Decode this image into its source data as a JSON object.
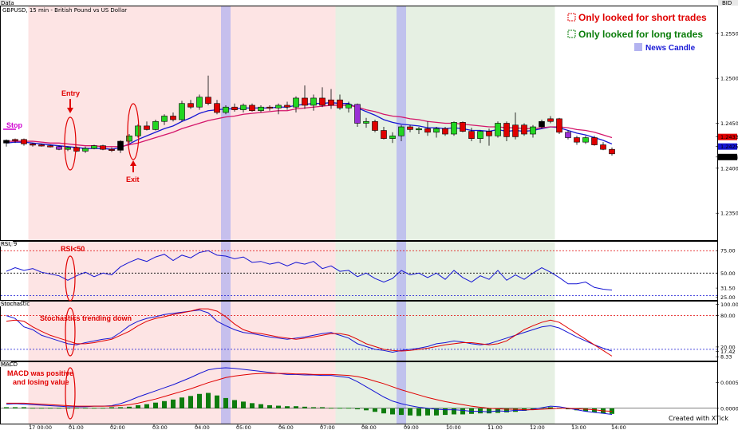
{
  "panes": {
    "price_label": "Data",
    "rsi_label": "RSI, 9",
    "stoch_label": "Stochastic",
    "macd_label": "MACD",
    "corner_label": "BID"
  },
  "title": "GBPUSD, 15 min - British Pound vs US Dollar",
  "legend": {
    "short": "Only looked for short trades",
    "long": "Only looked for long trades",
    "news": "News Candle",
    "short_color": "#e00000",
    "long_color": "#0a7d0a",
    "news_color": "#b3b3f0"
  },
  "annotations": {
    "stop": "Stop",
    "entry": "Entry",
    "exit": "Exit",
    "rsi": "RSI<50",
    "stoch": "Stochastics trending down",
    "macd_line1": "MACD was positive",
    "macd_line2": "and losing value"
  },
  "credit": "Created with XTick",
  "chart_data": {
    "type": "candlestick",
    "title": "GBPUSD, 15 min - British Pound vs US Dollar",
    "x_ticks": [
      "17 00:00",
      "01:00",
      "02:00",
      "03:00",
      "04:00",
      "05:00",
      "06:00",
      "07:00",
      "08:00",
      "09:00",
      "10:00",
      "11:00",
      "12:00",
      "13:00",
      "14:00"
    ],
    "price_axis": {
      "ticks": [
        "1.2550",
        "1.2500",
        "1.2450",
        "1.2400",
        "1.2350"
      ],
      "ylim": [
        1.232,
        1.258
      ],
      "value_labels": [
        "1.2433",
        "1.2425",
        "1.2416"
      ]
    },
    "candles": [
      {
        "o": 1.2428,
        "h": 1.2432,
        "l": 1.2424,
        "c": 1.2431,
        "color": "black"
      },
      {
        "o": 1.2431,
        "h": 1.2433,
        "l": 1.2428,
        "c": 1.2432,
        "color": "red"
      },
      {
        "o": 1.2432,
        "h": 1.2433,
        "l": 1.2425,
        "c": 1.2427,
        "color": "red"
      },
      {
        "o": 1.2427,
        "h": 1.2428,
        "l": 1.2424,
        "c": 1.2426,
        "color": "red"
      },
      {
        "o": 1.2426,
        "h": 1.2427,
        "l": 1.2424,
        "c": 1.2425,
        "color": "red"
      },
      {
        "o": 1.2425,
        "h": 1.2426,
        "l": 1.2423,
        "c": 1.2424,
        "color": "red"
      },
      {
        "o": 1.2424,
        "h": 1.2425,
        "l": 1.242,
        "c": 1.2421,
        "color": "purple"
      },
      {
        "o": 1.2421,
        "h": 1.2424,
        "l": 1.2419,
        "c": 1.2423,
        "color": "green"
      },
      {
        "o": 1.2423,
        "h": 1.2424,
        "l": 1.2418,
        "c": 1.2419,
        "color": "red"
      },
      {
        "o": 1.2419,
        "h": 1.2424,
        "l": 1.2417,
        "c": 1.2422,
        "color": "green"
      },
      {
        "o": 1.2422,
        "h": 1.2426,
        "l": 1.2421,
        "c": 1.2425,
        "color": "green"
      },
      {
        "o": 1.2425,
        "h": 1.2426,
        "l": 1.242,
        "c": 1.2421,
        "color": "red"
      },
      {
        "o": 1.2421,
        "h": 1.2423,
        "l": 1.2418,
        "c": 1.242,
        "color": "red"
      },
      {
        "o": 1.242,
        "h": 1.2431,
        "l": 1.2417,
        "c": 1.243,
        "color": "black"
      },
      {
        "o": 1.243,
        "h": 1.2438,
        "l": 1.2428,
        "c": 1.2436,
        "color": "green"
      },
      {
        "o": 1.2436,
        "h": 1.2449,
        "l": 1.2434,
        "c": 1.2447,
        "color": "green"
      },
      {
        "o": 1.2447,
        "h": 1.2452,
        "l": 1.2442,
        "c": 1.2443,
        "color": "red"
      },
      {
        "o": 1.2443,
        "h": 1.2454,
        "l": 1.2442,
        "c": 1.2452,
        "color": "green"
      },
      {
        "o": 1.2452,
        "h": 1.246,
        "l": 1.2448,
        "c": 1.2458,
        "color": "green"
      },
      {
        "o": 1.2458,
        "h": 1.2462,
        "l": 1.2452,
        "c": 1.2454,
        "color": "red"
      },
      {
        "o": 1.2454,
        "h": 1.2475,
        "l": 1.2452,
        "c": 1.2472,
        "color": "green"
      },
      {
        "o": 1.2472,
        "h": 1.2476,
        "l": 1.2466,
        "c": 1.2468,
        "color": "red"
      },
      {
        "o": 1.2468,
        "h": 1.2482,
        "l": 1.2465,
        "c": 1.2479,
        "color": "green"
      },
      {
        "o": 1.2479,
        "h": 1.2503,
        "l": 1.247,
        "c": 1.2472,
        "color": "red"
      },
      {
        "o": 1.2472,
        "h": 1.2476,
        "l": 1.246,
        "c": 1.2462,
        "color": "red"
      },
      {
        "o": 1.2462,
        "h": 1.247,
        "l": 1.246,
        "c": 1.2468,
        "color": "green"
      },
      {
        "o": 1.2468,
        "h": 1.2472,
        "l": 1.2463,
        "c": 1.2465,
        "color": "red"
      },
      {
        "o": 1.2465,
        "h": 1.2472,
        "l": 1.2462,
        "c": 1.247,
        "color": "green"
      },
      {
        "o": 1.247,
        "h": 1.2472,
        "l": 1.2463,
        "c": 1.2464,
        "color": "red"
      },
      {
        "o": 1.2464,
        "h": 1.247,
        "l": 1.2462,
        "c": 1.2468,
        "color": "green"
      },
      {
        "o": 1.2468,
        "h": 1.247,
        "l": 1.2464,
        "c": 1.2467,
        "color": "red"
      },
      {
        "o": 1.2467,
        "h": 1.2472,
        "l": 1.246,
        "c": 1.247,
        "color": "green"
      },
      {
        "o": 1.247,
        "h": 1.2474,
        "l": 1.2465,
        "c": 1.2468,
        "color": "red"
      },
      {
        "o": 1.2468,
        "h": 1.248,
        "l": 1.2462,
        "c": 1.2478,
        "color": "green"
      },
      {
        "o": 1.2478,
        "h": 1.2492,
        "l": 1.2466,
        "c": 1.247,
        "color": "red"
      },
      {
        "o": 1.247,
        "h": 1.2482,
        "l": 1.2464,
        "c": 1.2478,
        "color": "green"
      },
      {
        "o": 1.2478,
        "h": 1.249,
        "l": 1.2468,
        "c": 1.247,
        "color": "red"
      },
      {
        "o": 1.247,
        "h": 1.2488,
        "l": 1.2466,
        "c": 1.2476,
        "color": "red"
      },
      {
        "o": 1.2476,
        "h": 1.2482,
        "l": 1.2465,
        "c": 1.2467,
        "color": "red"
      },
      {
        "o": 1.2467,
        "h": 1.2474,
        "l": 1.2462,
        "c": 1.2471,
        "color": "green"
      },
      {
        "o": 1.2471,
        "h": 1.2472,
        "l": 1.2446,
        "c": 1.245,
        "color": "purple"
      },
      {
        "o": 1.245,
        "h": 1.2456,
        "l": 1.2445,
        "c": 1.2452,
        "color": "green"
      },
      {
        "o": 1.2452,
        "h": 1.2454,
        "l": 1.244,
        "c": 1.2442,
        "color": "red"
      },
      {
        "o": 1.2442,
        "h": 1.2446,
        "l": 1.2432,
        "c": 1.2433,
        "color": "red"
      },
      {
        "o": 1.2433,
        "h": 1.244,
        "l": 1.2428,
        "c": 1.2436,
        "color": "green"
      },
      {
        "o": 1.2436,
        "h": 1.2448,
        "l": 1.243,
        "c": 1.2446,
        "color": "green"
      },
      {
        "o": 1.2446,
        "h": 1.2448,
        "l": 1.244,
        "c": 1.2443,
        "color": "red"
      },
      {
        "o": 1.2443,
        "h": 1.2446,
        "l": 1.2438,
        "c": 1.2444,
        "color": "green"
      },
      {
        "o": 1.2444,
        "h": 1.2452,
        "l": 1.2436,
        "c": 1.244,
        "color": "red"
      },
      {
        "o": 1.244,
        "h": 1.2446,
        "l": 1.2434,
        "c": 1.2444,
        "color": "green"
      },
      {
        "o": 1.2444,
        "h": 1.2446,
        "l": 1.2436,
        "c": 1.2438,
        "color": "red"
      },
      {
        "o": 1.2438,
        "h": 1.2452,
        "l": 1.2436,
        "c": 1.2451,
        "color": "green"
      },
      {
        "o": 1.2451,
        "h": 1.2452,
        "l": 1.244,
        "c": 1.2441,
        "color": "red"
      },
      {
        "o": 1.2441,
        "h": 1.2445,
        "l": 1.243,
        "c": 1.2433,
        "color": "red"
      },
      {
        "o": 1.2433,
        "h": 1.2442,
        "l": 1.2428,
        "c": 1.2441,
        "color": "green"
      },
      {
        "o": 1.2441,
        "h": 1.2444,
        "l": 1.2425,
        "c": 1.2436,
        "color": "red"
      },
      {
        "o": 1.2436,
        "h": 1.2452,
        "l": 1.2434,
        "c": 1.245,
        "color": "green"
      },
      {
        "o": 1.245,
        "h": 1.2452,
        "l": 1.243,
        "c": 1.2435,
        "color": "red"
      },
      {
        "o": 1.2435,
        "h": 1.2462,
        "l": 1.2432,
        "c": 1.2448,
        "color": "red"
      },
      {
        "o": 1.2448,
        "h": 1.245,
        "l": 1.2436,
        "c": 1.2438,
        "color": "red"
      },
      {
        "o": 1.2438,
        "h": 1.2448,
        "l": 1.2434,
        "c": 1.2446,
        "color": "green"
      },
      {
        "o": 1.2446,
        "h": 1.2454,
        "l": 1.2444,
        "c": 1.2452,
        "color": "black"
      },
      {
        "o": 1.2452,
        "h": 1.2458,
        "l": 1.245,
        "c": 1.2455,
        "color": "red"
      },
      {
        "o": 1.2455,
        "h": 1.2456,
        "l": 1.2438,
        "c": 1.244,
        "color": "red"
      },
      {
        "o": 1.244,
        "h": 1.2442,
        "l": 1.2432,
        "c": 1.2434,
        "color": "purple"
      },
      {
        "o": 1.2434,
        "h": 1.2436,
        "l": 1.2426,
        "c": 1.2429,
        "color": "red"
      },
      {
        "o": 1.2429,
        "h": 1.2436,
        "l": 1.2427,
        "c": 1.2434,
        "color": "green"
      },
      {
        "o": 1.2434,
        "h": 1.2436,
        "l": 1.2425,
        "c": 1.2426,
        "color": "red"
      },
      {
        "o": 1.2426,
        "h": 1.2429,
        "l": 1.242,
        "c": 1.2421,
        "color": "red"
      },
      {
        "o": 1.2421,
        "h": 1.2423,
        "l": 1.2414,
        "c": 1.2416,
        "color": "red"
      }
    ],
    "series": [
      {
        "name": "",
        "color": "#1515d4",
        "values": [
          1.2428,
          1.2429,
          1.2429,
          1.2428,
          1.2427,
          1.2426,
          1.2425,
          1.2424,
          1.2423,
          1.2422,
          1.2422,
          1.2422,
          1.2421,
          1.2423,
          1.2427,
          1.2432,
          1.2436,
          1.244,
          1.2444,
          1.2447,
          1.2452,
          1.2456,
          1.2461,
          1.2464,
          1.2465,
          1.2466,
          1.2466,
          1.2467,
          1.2467,
          1.2467,
          1.2467,
          1.2468,
          1.2468,
          1.247,
          1.2471,
          1.2472,
          1.2472,
          1.2473,
          1.2472,
          1.2472,
          1.2467,
          1.2463,
          1.2459,
          1.2454,
          1.2451,
          1.2449,
          1.2448,
          1.2447,
          1.2445,
          1.2445,
          1.2444,
          1.2445,
          1.2444,
          1.2442,
          1.2442,
          1.2441,
          1.2443,
          1.2441,
          1.2442,
          1.2441,
          1.2442,
          1.2444,
          1.2446,
          1.2445,
          1.2442,
          1.2439,
          1.2437,
          1.2434,
          1.2431,
          1.2427
        ]
      },
      {
        "name": "",
        "color": "#d4156a",
        "values": [
          1.243,
          1.243,
          1.243,
          1.243,
          1.2429,
          1.2428,
          1.2428,
          1.2427,
          1.2426,
          1.2425,
          1.2425,
          1.2424,
          1.2424,
          1.2424,
          1.2426,
          1.2428,
          1.2431,
          1.2434,
          1.2437,
          1.244,
          1.2444,
          1.2447,
          1.245,
          1.2453,
          1.2455,
          1.2457,
          1.2458,
          1.246,
          1.2461,
          1.2462,
          1.2463,
          1.2464,
          1.2464,
          1.2466,
          1.2467,
          1.2468,
          1.2469,
          1.247,
          1.247,
          1.247,
          1.2468,
          1.2465,
          1.2463,
          1.246,
          1.2458,
          1.2457,
          1.2455,
          1.2454,
          1.2452,
          1.2451,
          1.245,
          1.245,
          1.2449,
          1.2448,
          1.2447,
          1.2446,
          1.2446,
          1.2445,
          1.2445,
          1.2444,
          1.2444,
          1.2445,
          1.2446,
          1.2446,
          1.2445,
          1.2443,
          1.2442,
          1.244,
          1.2437,
          1.2434
        ]
      }
    ],
    "rsi": {
      "label": "RSI, 9",
      "ticks": [
        "75.00",
        "50.00",
        "31.50",
        "25.00"
      ],
      "ylim": [
        20,
        85
      ],
      "values": [
        52,
        56,
        53,
        55,
        51,
        49,
        47,
        42,
        47,
        51,
        46,
        50,
        48,
        57,
        62,
        66,
        63,
        68,
        71,
        64,
        70,
        67,
        73,
        75,
        70,
        69,
        66,
        68,
        62,
        63,
        60,
        62,
        58,
        62,
        60,
        63,
        55,
        58,
        52,
        53,
        46,
        50,
        44,
        40,
        44,
        53,
        48,
        50,
        45,
        50,
        43,
        53,
        45,
        40,
        47,
        43,
        53,
        42,
        48,
        43,
        50,
        56,
        51,
        45,
        38,
        38,
        40,
        34,
        32,
        31
      ]
    },
    "stochastic": {
      "label": "Stochastic",
      "ticks": [
        "100.00",
        "80.00",
        "20.00",
        "17.42",
        "8.33"
      ],
      "ylim": [
        0,
        105
      ],
      "k": [
        80,
        75,
        60,
        55,
        45,
        40,
        35,
        30,
        28,
        32,
        35,
        38,
        40,
        50,
        62,
        70,
        75,
        78,
        82,
        84,
        86,
        88,
        90,
        85,
        70,
        62,
        55,
        50,
        48,
        45,
        42,
        40,
        38,
        40,
        42,
        45,
        48,
        50,
        45,
        40,
        30,
        25,
        20,
        18,
        15,
        18,
        20,
        22,
        25,
        30,
        32,
        35,
        33,
        30,
        28,
        30,
        35,
        40,
        45,
        50,
        55,
        60,
        62,
        58,
        50,
        42,
        35,
        28,
        22,
        17
      ],
      "d": [
        70,
        72,
        70,
        60,
        52,
        45,
        40,
        35,
        30,
        30,
        32,
        35,
        38,
        45,
        52,
        62,
        70,
        75,
        78,
        82,
        85,
        88,
        92,
        92,
        88,
        78,
        65,
        55,
        50,
        48,
        45,
        42,
        40,
        38,
        40,
        42,
        45,
        48,
        48,
        45,
        38,
        30,
        25,
        20,
        18,
        17,
        18,
        20,
        22,
        25,
        28,
        30,
        32,
        32,
        30,
        28,
        30,
        35,
        45,
        55,
        62,
        68,
        72,
        68,
        58,
        48,
        38,
        28,
        18,
        8
      ]
    },
    "macd": {
      "label": "MACD",
      "ticks": [
        "0.0005",
        "0.0000"
      ],
      "ylim": [
        -0.0003,
        0.0009
      ],
      "hist": [
        2e-05,
        2e-05,
        2e-05,
        1e-05,
        1e-05,
        1e-05,
        1e-05,
        1e-05,
        1e-05,
        1e-05,
        1e-05,
        1e-05,
        2e-05,
        2e-05,
        3e-05,
        6e-05,
        8e-05,
        0.00011,
        0.00014,
        0.00017,
        0.00021,
        0.00024,
        0.00028,
        0.0003,
        0.00025,
        0.0002,
        0.00016,
        0.00013,
        0.0001,
        8e-05,
        6e-05,
        5e-05,
        4e-05,
        4e-05,
        3e-05,
        2e-05,
        2e-05,
        1e-05,
        1e-05,
        1e-05,
        -2e-05,
        -4e-05,
        -7e-05,
        -0.0001,
        -0.00012,
        -0.00013,
        -0.00014,
        -0.00015,
        -0.00014,
        -0.00014,
        -0.00013,
        -0.00012,
        -0.00012,
        -0.00011,
        -0.0001,
        -0.0001,
        -9e-05,
        -8e-05,
        -7e-05,
        -5e-05,
        -2e-05,
        1e-05,
        2e-05,
        1e-05,
        -2e-05,
        -4e-05,
        -6e-05,
        -8e-05,
        -0.0001,
        -0.00011
      ],
      "macd_line": [
        8e-05,
        9e-05,
        8e-05,
        7e-05,
        6e-05,
        5e-05,
        4e-05,
        3e-05,
        3e-05,
        3e-05,
        4e-05,
        4e-05,
        5e-05,
        9e-05,
        0.00015,
        0.00022,
        0.00028,
        0.00034,
        0.0004,
        0.00046,
        0.00053,
        0.0006,
        0.00068,
        0.00075,
        0.00078,
        0.00079,
        0.00078,
        0.00076,
        0.00074,
        0.00072,
        0.0007,
        0.00068,
        0.00066,
        0.00066,
        0.00065,
        0.00065,
        0.00064,
        0.00064,
        0.00062,
        0.0006,
        0.00052,
        0.00042,
        0.00032,
        0.00022,
        0.00014,
        9e-05,
        5e-05,
        2e-05,
        0.0,
        -2e-05,
        -3e-05,
        -3e-05,
        -4e-05,
        -6e-05,
        -6e-05,
        -7e-05,
        -5e-05,
        -6e-05,
        -4e-05,
        -4e-05,
        -2e-05,
        1e-05,
        4e-05,
        3e-05,
        0.0,
        -3e-05,
        -6e-05,
        -8e-05,
        -0.0001,
        -0.00012
      ],
      "signal_line": [
        0.0001,
        0.0001,
        0.0001,
        9e-05,
        8e-05,
        7e-05,
        6e-05,
        5e-05,
        4e-05,
        4e-05,
        4e-05,
        4e-05,
        4e-05,
        5e-05,
        7e-05,
        0.0001,
        0.00014,
        0.00018,
        0.00023,
        0.00028,
        0.00033,
        0.00038,
        0.00044,
        0.0005,
        0.00055,
        0.0006,
        0.00063,
        0.00065,
        0.00067,
        0.00068,
        0.00068,
        0.00068,
        0.00068,
        0.00067,
        0.00067,
        0.00066,
        0.00066,
        0.00066,
        0.00065,
        0.00064,
        0.00062,
        0.00058,
        0.00053,
        0.00048,
        0.00042,
        0.00036,
        0.00031,
        0.00026,
        0.00021,
        0.00017,
        0.00013,
        0.0001,
        7e-05,
        4e-05,
        2e-05,
        0.0,
        -1e-05,
        -2e-05,
        -2e-05,
        -3e-05,
        -3e-05,
        -2e-05,
        -1e-05,
        0.0,
        0.0,
        -1e-05,
        -2e-05,
        -3e-05,
        -5e-05,
        -6e-05
      ]
    },
    "regions": [
      {
        "label": "Only looked for short trades",
        "from_candle": 3,
        "to_candle": 38,
        "color": "#fde4e4"
      },
      {
        "label": "Only looked for long trades",
        "from_candle": 38,
        "to_candle": 63,
        "color": "#e6f0e3"
      }
    ],
    "news_candles": [
      25,
      45
    ]
  }
}
